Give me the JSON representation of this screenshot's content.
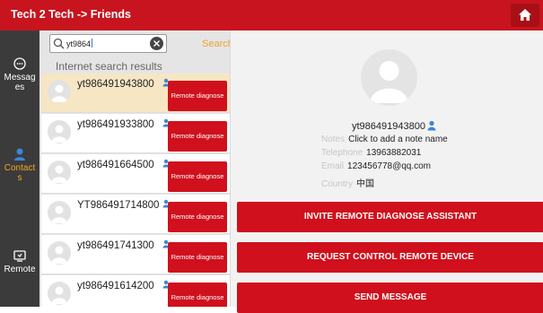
{
  "titlebar": {
    "title": "Tech 2 Tech -> Friends",
    "home_icon": "home-icon"
  },
  "sidebar": {
    "items": [
      {
        "label": "Messag\nes",
        "icon": "message-icon"
      },
      {
        "label": "Contact\ns",
        "icon": "contact-icon",
        "active": true
      },
      {
        "label": "Remote",
        "icon": "remote-icon"
      }
    ]
  },
  "search": {
    "value": "yt9864",
    "search_label": "Search",
    "clear_icon": "clear-icon"
  },
  "results_label": "Internet search results",
  "results": [
    {
      "name": "yt986491943800",
      "button": "Remote diagnose",
      "selected": true
    },
    {
      "name": "yt986491933800",
      "button": "Remote diagnose"
    },
    {
      "name": "yt986491664500",
      "button": "Remote diagnose"
    },
    {
      "name": "YT986491714800",
      "button": "Remote diagnose"
    },
    {
      "name": "yt986491741300",
      "button": "Remote diagnose"
    },
    {
      "name": "yt986491614200",
      "button": "Remote diagnose"
    }
  ],
  "detail": {
    "name": "yt986491943800",
    "notes_key": "Notes",
    "notes_value": "Click to add a note name",
    "telephone_key": "Telephone",
    "telephone_value": "13963882031",
    "email_key": "Email",
    "email_value": "123456778@qq.com",
    "country_key": "Country",
    "country_value": "中国"
  },
  "actions": {
    "invite": "INVITE REMOTE DIAGNOSE ASSISTANT",
    "request": "REQUEST CONTROL REMOTE DEVICE",
    "send": "SEND MESSAGE"
  },
  "colors": {
    "brand_red": "#c8141e",
    "accent_orange": "#f5a623",
    "person_blue": "#3a86d6"
  }
}
